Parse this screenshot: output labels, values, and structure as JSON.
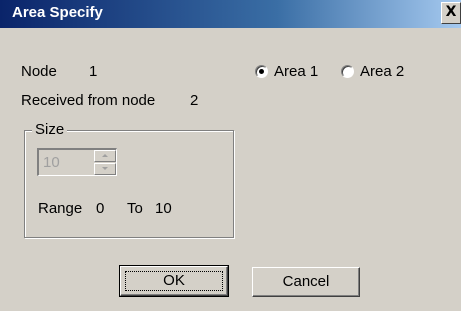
{
  "window": {
    "title": "Area Specify",
    "close_label": "X"
  },
  "node": {
    "label": "Node",
    "value": "1"
  },
  "received": {
    "label": "Received from node",
    "value": "2"
  },
  "area_options": [
    {
      "label": "Area 1",
      "selected": true
    },
    {
      "label": "Area 2",
      "selected": false
    }
  ],
  "size_group": {
    "label": "Size",
    "value": "10",
    "range_label": "Range",
    "range_min": "0",
    "to_label": "To",
    "range_max": "10"
  },
  "buttons": {
    "ok": "OK",
    "cancel": "Cancel"
  }
}
